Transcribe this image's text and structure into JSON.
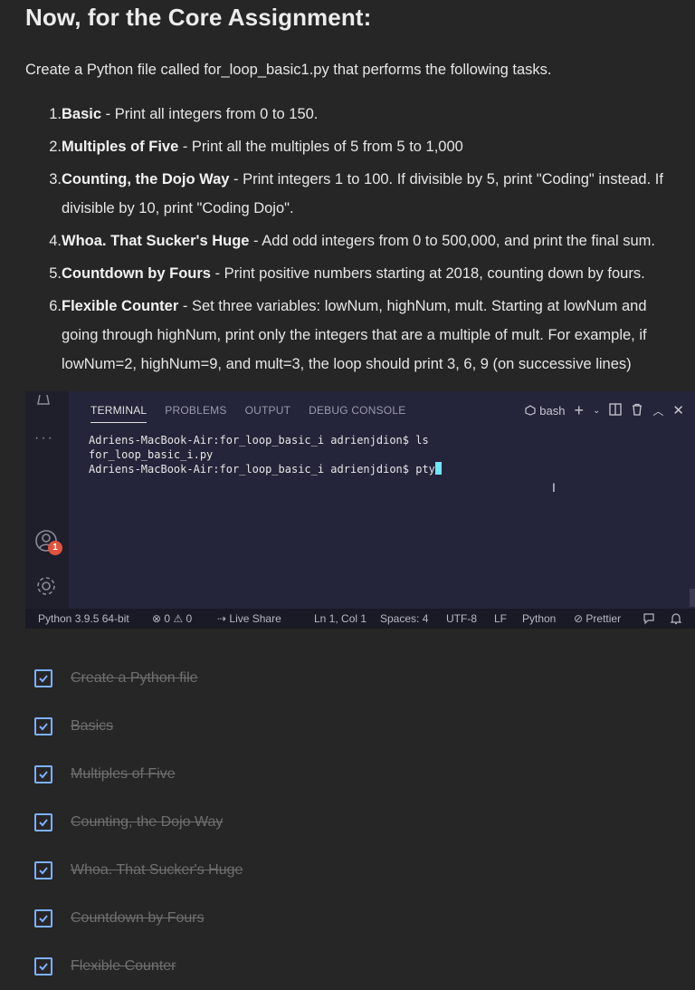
{
  "heading": "Now, for the Core Assignment:",
  "intro": "Create a Python file called for_loop_basic1.py that performs the following tasks.",
  "tasks": [
    {
      "num": "1.",
      "title": "Basic",
      "desc": " - Print all integers from 0 to 150."
    },
    {
      "num": "2.",
      "title": "Multiples of Five",
      "desc": " - Print all the multiples of 5 from 5 to 1,000"
    },
    {
      "num": "3.",
      "title": "Counting, the Dojo Way",
      "desc": " - Print integers 1 to 100. If divisible by 5, print \"Coding\" instead. If",
      "cont": "divisible by 10, print \"Coding Dojo\"."
    },
    {
      "num": "4.",
      "title": "Whoa. That Sucker's Huge",
      "desc": " - Add odd integers from 0 to 500,000, and print the final sum."
    },
    {
      "num": "5.",
      "title": "Countdown by Fours",
      "desc": " - Print positive numbers starting at 2018, counting down by fours."
    },
    {
      "num": "6.",
      "title": "Flexible Counter",
      "desc": " - Set three variables: lowNum, highNum, mult. Starting at lowNum and",
      "cont": "going through highNum, print only the integers that are a multiple of mult. For example, if",
      "cont2": "lowNum=2, highNum=9, and mult=3, the loop should print 3, 6, 9 (on successive lines)"
    }
  ],
  "vscode": {
    "tabs": [
      "TERMINAL",
      "PROBLEMS",
      "OUTPUT",
      "DEBUG CONSOLE"
    ],
    "shell": "bash",
    "badge_count": "1",
    "terminal_lines": [
      "Adriens-MacBook-Air:for_loop_basic_i adrienjdion$ ls",
      "for_loop_basic_i.py",
      "Adriens-MacBook-Air:for_loop_basic_i adrienjdion$ pty"
    ],
    "status": {
      "python": "Python 3.9.5 64-bit",
      "problems": "⊗ 0 ⚠ 0",
      "live_share": "Live Share",
      "position": "Ln 1, Col 1",
      "spaces": "Spaces: 4",
      "encoding": "UTF-8",
      "eol": "LF",
      "language": "Python",
      "prettier": "Prettier"
    }
  },
  "checklist": [
    "Create a Python file",
    "Basics",
    "Multiples of Five",
    "Counting, the Dojo Way",
    "Whoa. That Sucker's Huge",
    "Countdown by Fours",
    "Flexible Counter"
  ],
  "colors": {
    "accent": "#7fb0ff",
    "badge": "#e0533e",
    "cursor": "#6ee7ff"
  }
}
